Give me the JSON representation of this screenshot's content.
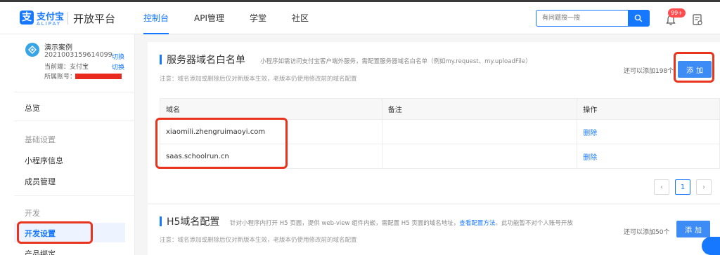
{
  "brand": {
    "logo_mark": "支",
    "name": "支付宝",
    "name_en": "ALIPAY",
    "platform": "开放平台",
    "color": "#1677ff"
  },
  "nav": {
    "items": [
      {
        "label": "控制台",
        "active": true
      },
      {
        "label": "API管理",
        "active": false
      },
      {
        "label": "学堂",
        "active": false
      },
      {
        "label": "社区",
        "active": false
      }
    ]
  },
  "search": {
    "placeholder": "有问题搜一搜",
    "icon": "search-icon"
  },
  "notifications": {
    "badge": "99+",
    "icon": "bell-icon"
  },
  "sidebar": {
    "app": {
      "name": "演示案例",
      "id": "2021003159614099",
      "switch_label": "切换",
      "terminal_label": "当前端：支付宝",
      "switch2_label": "切换",
      "account_label": "所属账号："
    },
    "overview": "总览",
    "group_basic": "基础设置",
    "app_info": "小程序信息",
    "members": "成员管理",
    "group_dev": "开发",
    "dev_settings": "开发设置",
    "product_bind": "产品绑定"
  },
  "server_section": {
    "title": "服务器域名白名单",
    "desc": "小程序如需访问支付宝客户端外服务，需配置服务器域名白名单（例如my.request、my.uploadFile）",
    "note": "注意：域名添加或删除后仅对新版本生效，老版本仍使用修改前的域名配置",
    "remaining": "还可以添加198个",
    "add_label": "添加",
    "table": {
      "headers": [
        "域名",
        "备注",
        "操作"
      ],
      "rows": [
        {
          "domain": "xiaomili.zhengruimaoyi.com",
          "remark": "",
          "action": "删除"
        },
        {
          "domain": "saas.schoolrun.cn",
          "remark": "",
          "action": "删除"
        }
      ]
    },
    "pagination": {
      "prev": "‹",
      "current": "1",
      "next": "›"
    }
  },
  "h5_section": {
    "title": "H5域名配置",
    "desc_pre": "针对小程序内打开 H5 页面，提供 web-view 组件内嵌，需配置 H5 页面的域名地址，",
    "desc_link": "查看配置方法",
    "desc_post": "。此功能暂不对个人账号开放",
    "note": "注意：域名添加或删除后仅对新版本生效，老版本仍使用修改前的域名配置",
    "remaining": "还可以添加50个",
    "add_label": "添加"
  },
  "colors": {
    "accent": "#1677ff",
    "annotation": "#e8341c",
    "badge": "#ff4d4f"
  }
}
